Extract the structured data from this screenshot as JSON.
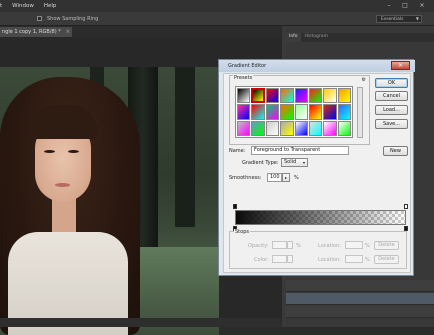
{
  "menubar": {
    "items": [
      "t",
      "Window",
      "Help"
    ]
  },
  "options": {
    "sample_ring_label": "Show Sampling Ring"
  },
  "workspace": {
    "value": "Essentials"
  },
  "document": {
    "tab_label": "ngle 1 copy 1, RGB/8) *"
  },
  "panel_tabs": [
    "Info",
    "Histogram"
  ],
  "gradient_editor": {
    "title": "Gradient Editor",
    "presets_label": "Presets",
    "name_label": "Name:",
    "name_value": "Foreground to Transparent",
    "gradient_type_label": "Gradient Type:",
    "gradient_type_value": "Solid",
    "smoothness_label": "Smoothness:",
    "smoothness_value": "100",
    "smoothness_unit": "%",
    "buttons": {
      "ok": "OK",
      "cancel": "Cancel",
      "load": "Load...",
      "save": "Save...",
      "new": "New"
    },
    "stops": {
      "label": "Stops",
      "opacity_label": "Opacity:",
      "opacity_unit": "%",
      "location_label": "Location:",
      "location_unit": "%",
      "color_label": "Color:",
      "delete_label": "Delete"
    },
    "preset_swatches": [
      "#000000",
      "#000000",
      "#ff0000",
      "#ff6600",
      "#2020ff",
      "#ff2020",
      "#ffcc00",
      "#ff9900",
      "#ff3399",
      "#ff0000",
      "#00cc66",
      "#ff6600",
      "#99ff99",
      "#ff0000",
      "#cc3300",
      "#3366ff",
      "#c0c0c0",
      "#6699cc",
      "#cccccc",
      "#aaaaaa",
      "#ffffff",
      "#e0e0e0",
      "#ffffff",
      "#ffffff"
    ]
  }
}
